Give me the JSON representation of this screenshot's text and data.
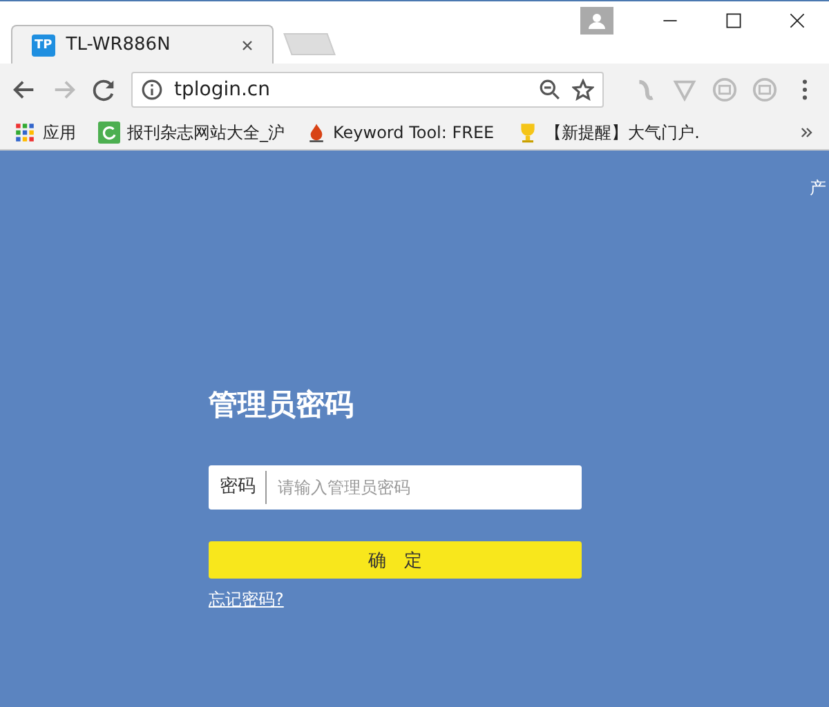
{
  "browser": {
    "tab": {
      "title": "TL-WR886N",
      "favicon": "TP"
    },
    "address": "tplogin.cn",
    "bookmarks": [
      {
        "label": "应用"
      },
      {
        "label": "报刊杂志网站大全_沪"
      },
      {
        "label": "Keyword Tool: FREE"
      },
      {
        "label": "【新提醒】大气门户."
      }
    ]
  },
  "page": {
    "corner_text": "产",
    "title": "管理员密码",
    "password_label": "密码",
    "password_placeholder": "请输入管理员密码",
    "confirm_button": "确　定",
    "forgot_link": "忘记密码?"
  }
}
